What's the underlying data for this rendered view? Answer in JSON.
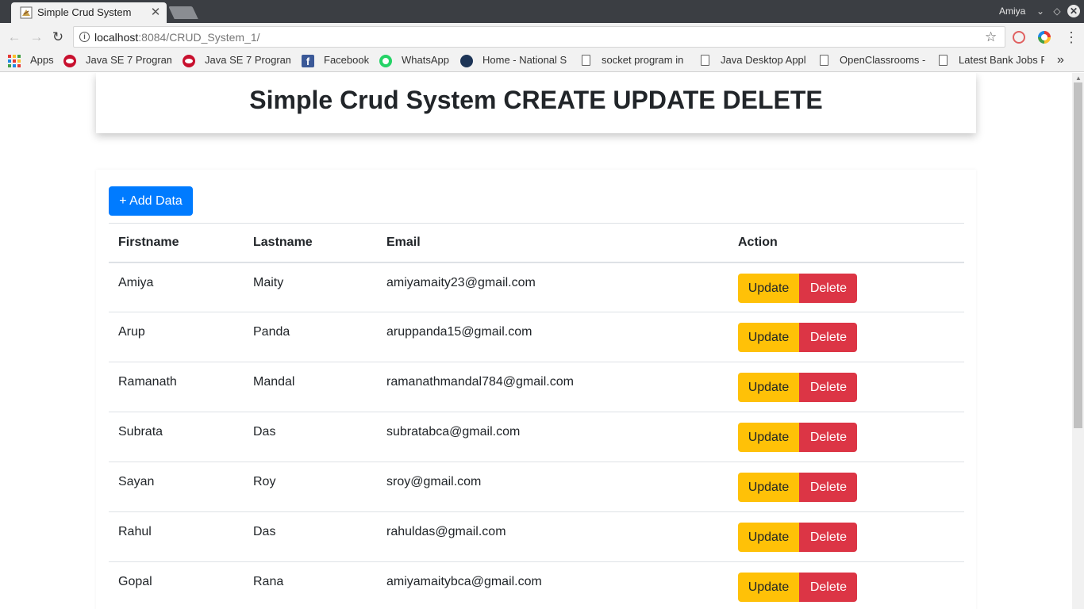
{
  "browser": {
    "tab_title": "Simple Crud System",
    "profile_name": "Amiya",
    "url_host": "localhost",
    "url_rest": ":8084/CRUD_System_1/",
    "bookmarks": [
      {
        "label": "Apps",
        "icon": "apps-grid-icon"
      },
      {
        "label": "Java SE 7 Program",
        "icon": "oracle-icon"
      },
      {
        "label": "Java SE 7 Program",
        "icon": "oracle-icon"
      },
      {
        "label": "Facebook",
        "icon": "facebook-icon"
      },
      {
        "label": "WhatsApp",
        "icon": "whatsapp-icon"
      },
      {
        "label": "Home - National S",
        "icon": "national-icon"
      },
      {
        "label": "socket program in",
        "icon": "page-icon"
      },
      {
        "label": "Java Desktop Appl",
        "icon": "page-icon"
      },
      {
        "label": "OpenClassrooms -",
        "icon": "page-icon"
      },
      {
        "label": "Latest Bank Jobs R",
        "icon": "page-icon"
      }
    ]
  },
  "page": {
    "title": "Simple Crud System CREATE UPDATE DELETE",
    "add_button": "+ Add Data",
    "columns": [
      "Firstname",
      "Lastname",
      "Email",
      "Action"
    ],
    "update_label": "Update",
    "delete_label": "Delete",
    "rows": [
      {
        "firstname": "Amiya",
        "lastname": "Maity",
        "email": "amiyamaity23@gmail.com"
      },
      {
        "firstname": "Arup",
        "lastname": "Panda",
        "email": "aruppanda15@gmail.com"
      },
      {
        "firstname": "Ramanath",
        "lastname": "Mandal",
        "email": "ramanathmandal784@gmail.com"
      },
      {
        "firstname": "Subrata",
        "lastname": "Das",
        "email": "subratabca@gmail.com"
      },
      {
        "firstname": "Sayan",
        "lastname": "Roy",
        "email": "sroy@gmail.com"
      },
      {
        "firstname": "Rahul",
        "lastname": "Das",
        "email": "rahuldas@gmail.com"
      },
      {
        "firstname": "Gopal",
        "lastname": "Rana",
        "email": "amiyamaitybca@gmail.com"
      }
    ]
  },
  "colors": {
    "primary": "#007bff",
    "warning": "#ffc107",
    "danger": "#dc3545",
    "text": "#212529"
  }
}
